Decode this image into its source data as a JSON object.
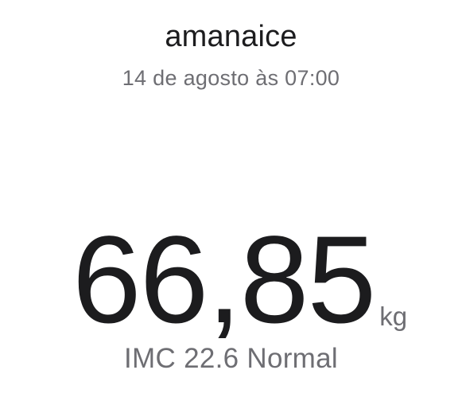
{
  "header": {
    "user_name": "amanaice",
    "timestamp": "14 de agosto às 07:00"
  },
  "measurement": {
    "weight": "66,85",
    "unit": "kg"
  },
  "bmi": {
    "label": "IMC",
    "value": "22.6",
    "category": "Normal"
  }
}
